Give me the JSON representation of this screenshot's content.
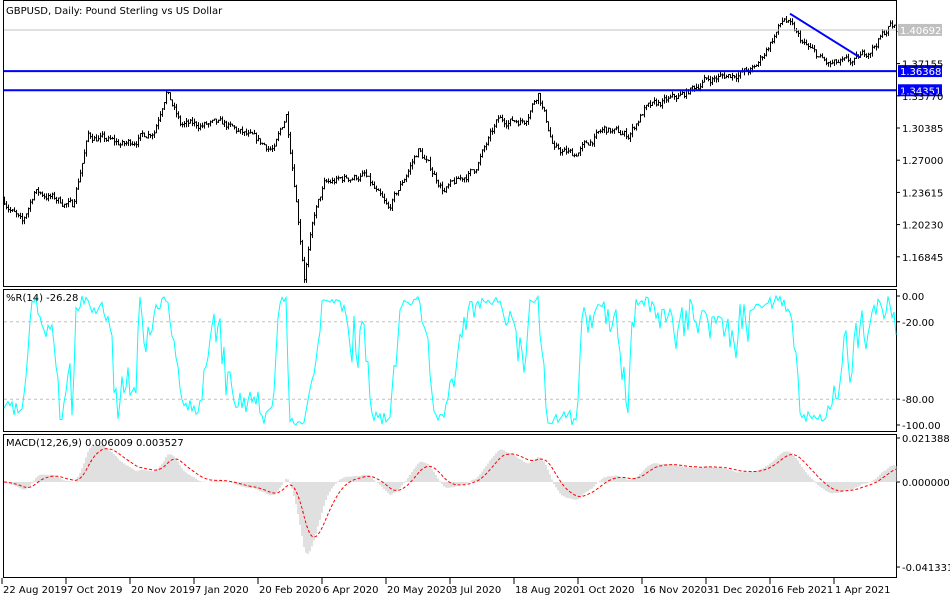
{
  "chart_data": {
    "type": "candlestick-ohlc",
    "title": "GBPUSD, Daily:  Pound Sterling vs US Dollar",
    "symbol": "GBPUSD",
    "timeframe": "Daily",
    "price_axis": {
      "range": [
        1.145,
        1.428
      ],
      "ticks": [
        "1.37155",
        "1.33770",
        "1.30385",
        "1.27000",
        "1.23615",
        "1.20230",
        "1.16845"
      ],
      "current_price_label": "1.40692",
      "current_price": 1.40692
    },
    "horizontal_levels": [
      {
        "label": "1.36368",
        "value": 1.36368,
        "color": "#0000ff"
      },
      {
        "label": "1.34351",
        "value": 1.34351,
        "color": "#0000ff"
      }
    ],
    "trendline": {
      "from": {
        "bar": 393,
        "price": 1.424
      },
      "to": {
        "bar": 428,
        "price": 1.378
      },
      "color": "#0000ff"
    },
    "price_path_anchors": [
      [
        0,
        1.228
      ],
      [
        9,
        1.202
      ],
      [
        15,
        1.238
      ],
      [
        34,
        1.222
      ],
      [
        42,
        1.296
      ],
      [
        60,
        1.286
      ],
      [
        75,
        1.302
      ],
      [
        81,
        1.344
      ],
      [
        88,
        1.307
      ],
      [
        110,
        1.307
      ],
      [
        135,
        1.281
      ],
      [
        141,
        1.318
      ],
      [
        145,
        1.249
      ],
      [
        150,
        1.149
      ],
      [
        155,
        1.212
      ],
      [
        160,
        1.244
      ],
      [
        170,
        1.251
      ],
      [
        180,
        1.254
      ],
      [
        192,
        1.217
      ],
      [
        207,
        1.281
      ],
      [
        220,
        1.238
      ],
      [
        235,
        1.26
      ],
      [
        247,
        1.312
      ],
      [
        260,
        1.312
      ],
      [
        267,
        1.342
      ],
      [
        275,
        1.281
      ],
      [
        285,
        1.276
      ],
      [
        300,
        1.302
      ],
      [
        312,
        1.296
      ],
      [
        320,
        1.323
      ],
      [
        340,
        1.339
      ],
      [
        350,
        1.354
      ],
      [
        375,
        1.365
      ],
      [
        390,
        1.419
      ],
      [
        400,
        1.391
      ],
      [
        412,
        1.37
      ],
      [
        425,
        1.373
      ],
      [
        435,
        1.391
      ],
      [
        443,
        1.412
      ],
      [
        446,
        1.407
      ]
    ],
    "x_axis": {
      "labels": [
        "22 Aug 2019",
        "7 Oct 2019",
        "20 Nov 2019",
        "7 Jan 2020",
        "20 Feb 2020",
        "6 Apr 2020",
        "20 May 2020",
        "3 Jul 2020",
        "18 Aug 2020",
        "1 Oct 2020",
        "16 Nov 2020",
        "31 Dec 2020",
        "16 Feb 2021",
        "1 Apr 2021"
      ],
      "bars_per_label": 32
    },
    "wpr": {
      "label": "%R(14) -26.28",
      "period": 14,
      "range": [
        -100,
        0
      ],
      "ticks": [
        "0.00",
        "-20.00",
        "-80.00",
        "-100.00"
      ],
      "levels": [
        -20,
        -80
      ],
      "color": "#00ffff"
    },
    "macd": {
      "label": "MACD(12,26,9) 0.006009 0.003527",
      "params": [
        12,
        26,
        9
      ],
      "main": 0.006009,
      "signal": 0.003527,
      "range": [
        -0.041331,
        0.021388
      ],
      "ticks": [
        "0.021388",
        "0.000000",
        "-0.041331"
      ],
      "histogram_color": "#c0c0c0",
      "signal_color": "#ff0000"
    }
  }
}
